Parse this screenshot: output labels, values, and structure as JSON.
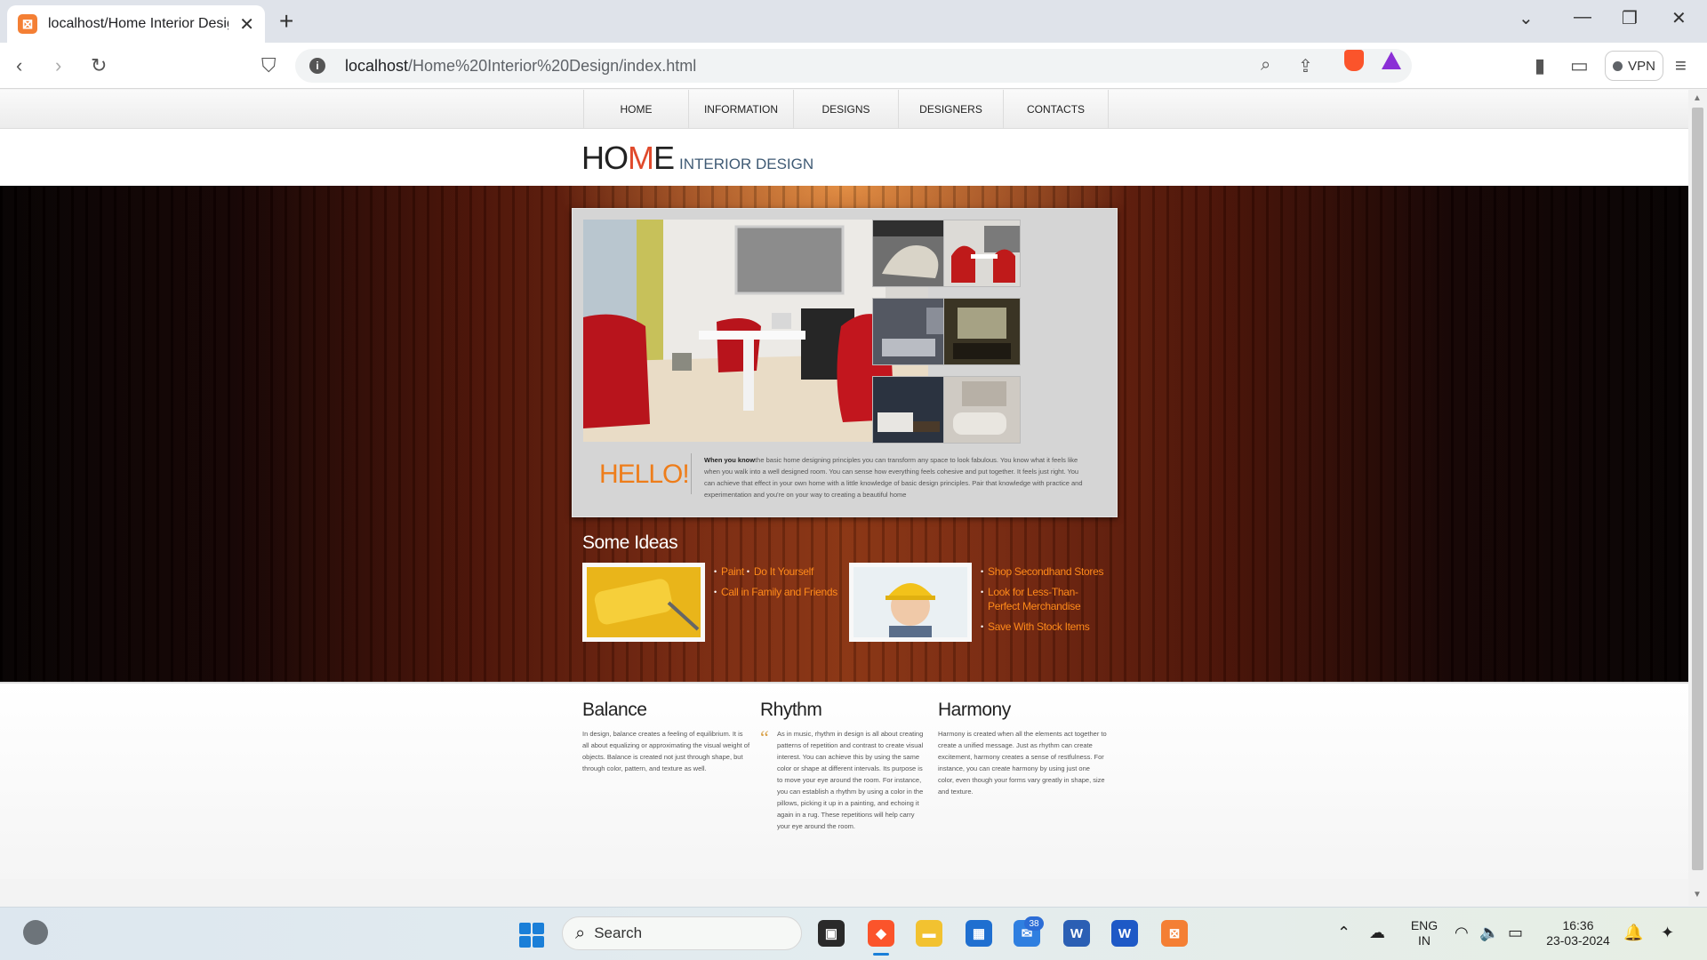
{
  "browser": {
    "tab_title": "localhost/Home Interior Design/",
    "url_host": "localhost",
    "url_path": "/Home%20Interior%20Design/index.html",
    "vpn_label": "VPN",
    "icons": [
      "back-icon",
      "forward-icon",
      "reload-icon",
      "bookmark-icon",
      "zoom-icon",
      "share-icon",
      "brave-shields-icon",
      "rewards-icon",
      "sidebar-icon",
      "wallet-icon",
      "menu-icon"
    ]
  },
  "site": {
    "nav": [
      "HOME",
      "INFORMATION",
      "DESIGNS",
      "DESIGNERS",
      "CONTACTS"
    ],
    "logo_ho": "HO",
    "logo_m": "M",
    "logo_e": "E",
    "logo_sub": "INTERIOR DESIGN",
    "hello": "HELLO!",
    "hello_lead": "When you know",
    "hello_body": "the basic home designing principles you can transform any space to look fabulous. You know what it feels like when you walk into a well designed room. You can sense how everything feels cohesive and put together. It feels just right. You can achieve that effect in your own home with a little knowledge of basic design principles. Pair that knowledge with practice and experimentation and you're on your way to creating a beautiful home",
    "ideas_title": "Some Ideas",
    "ideas_left": [
      "Paint",
      "Do It Yourself",
      "Call in Family and Friends"
    ],
    "ideas_right": [
      "Shop Secondhand Stores",
      "Look for Less-Than-Perfect Merchandise",
      "Save With Stock Items"
    ],
    "balance_title": "Balance",
    "balance_text": "In design, balance creates a feeling of equilibrium. It is all about equalizing or approximating the visual weight of objects. Balance is created not just through shape, but through color, pattern, and texture as well.",
    "rhythm_title": "Rhythm",
    "rhythm_text": "As in music, rhythm in design is all about creating patterns of repetition and contrast to create visual interest. You can achieve this by using the same color or shape at different intervals. Its purpose is to move your eye around the room. For instance, you can establish a rhythm by using a color in the pillows, picking it up in a painting, and echoing it again in a rug. These repetitions will help carry your eye around the room.",
    "harmony_title": "Harmony",
    "harmony_text": "Harmony is created when all the elements act together to create a unified message. Just as rhythm can create excitement, harmony creates a sense of restfulness. For instance, you can create harmony by using just one color, even though your forms vary greatly in shape, size and texture.",
    "colors": {
      "accent_orange": "#ee7d1a",
      "logo_red": "#e04a2c",
      "logo_sub": "#3f5a74"
    }
  },
  "taskbar": {
    "search_label": "Search",
    "mail_badge": "38",
    "lang_line1": "ENG",
    "lang_line2": "IN",
    "time": "16:36",
    "date": "23-03-2024"
  }
}
